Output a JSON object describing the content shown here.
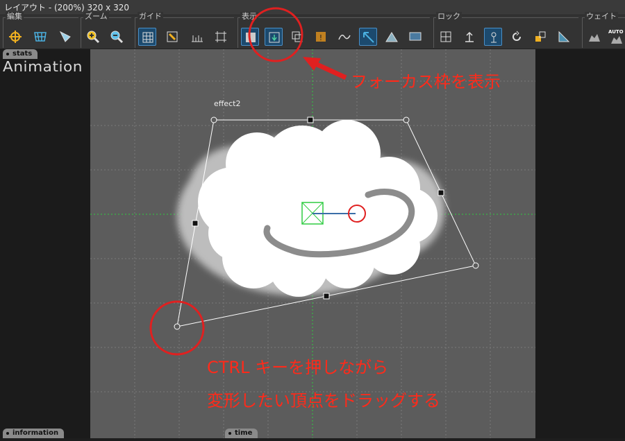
{
  "window": {
    "title": "レイアウト - (200%) 320 x 320"
  },
  "toolbar": {
    "groups": [
      {
        "label": "編集"
      },
      {
        "label": "ズーム"
      },
      {
        "label": "ガイド"
      },
      {
        "label": "表示"
      },
      {
        "label": "ロック"
      },
      {
        "label": "ウェイト"
      }
    ],
    "auto_label": "AUTO"
  },
  "panels": {
    "stats_tab": "stats",
    "information_tab": "information",
    "time_tab": "time",
    "animation_title": "Animation"
  },
  "canvas": {
    "object_label": "effect2"
  },
  "annotations": {
    "focus_frame": "フォーカス枠を表示",
    "instruction_line1": "CTRL キーを押しながら",
    "instruction_line2": "変形したい頂点をドラッグする"
  },
  "colors": {
    "annotation_red": "#ff2a1a",
    "canvas_bg": "#5c5c5c",
    "guide_green": "#2ecc40",
    "active_button": "#1c4a6e"
  }
}
